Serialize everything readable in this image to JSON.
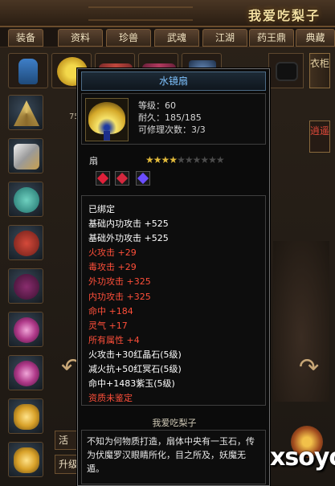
{
  "banner": {
    "title": "我爱吃梨子"
  },
  "tabs": [
    {
      "label": "装备"
    },
    {
      "label": "资料"
    },
    {
      "label": "珍兽"
    },
    {
      "label": "武魂"
    },
    {
      "label": "江湖"
    },
    {
      "label": "药王鼎"
    },
    {
      "label": "典藏"
    }
  ],
  "side": {
    "clothes_tab": "衣柜",
    "xiaoyao_tab": "逍遥",
    "partial_number": "75"
  },
  "bottom": {
    "label1": "活",
    "label2": "升级"
  },
  "tooltip": {
    "item_name": "水镜扇",
    "level": "等级：60",
    "durability": "耐久：185/185",
    "repair": "可修理次数：3/3",
    "type": "扇",
    "stars_filled": 4,
    "stars_total": 10,
    "gems": [
      {
        "icon": "red-gem-icon",
        "color": "#e0203a"
      },
      {
        "icon": "red-gem-icon",
        "color": "#d4283e"
      },
      {
        "icon": "purple-gem-icon",
        "color": "#6b4dff"
      }
    ],
    "attributes": [
      {
        "text": "已绑定",
        "color": "#ffffff"
      },
      {
        "text": "基础内功攻击 +525",
        "color": "#ffffff"
      },
      {
        "text": "基础外功攻击 +525",
        "color": "#ffffff"
      },
      {
        "text": "火攻击 +29",
        "color": "#ff4f3a"
      },
      {
        "text": "毒攻击 +29",
        "color": "#ff4f3a"
      },
      {
        "text": "外功攻击 +325",
        "color": "#ff4f3a"
      },
      {
        "text": "内功攻击 +325",
        "color": "#ff4f3a"
      },
      {
        "text": "命中 +184",
        "color": "#ff4f3a"
      },
      {
        "text": "灵气 +17",
        "color": "#ff4f3a"
      },
      {
        "text": "所有属性 +4",
        "color": "#ff4f3a"
      },
      {
        "text": "火攻击+30红晶石(5级)",
        "color": "#ffffff"
      },
      {
        "text": "减火抗+50红冥石(5级)",
        "color": "#ffffff"
      },
      {
        "text": "命中+1483紫玉(5级)",
        "color": "#ffffff"
      },
      {
        "text": "资质未鉴定",
        "color": "#ff4f3a"
      }
    ],
    "author": "我爱吃梨子",
    "description": "不知为何物质打造，扇体中央有一玉石，传为伏魔罗汉眼睛所化，目之所及，妖魔无遁。"
  },
  "watermark": "xsoyo"
}
